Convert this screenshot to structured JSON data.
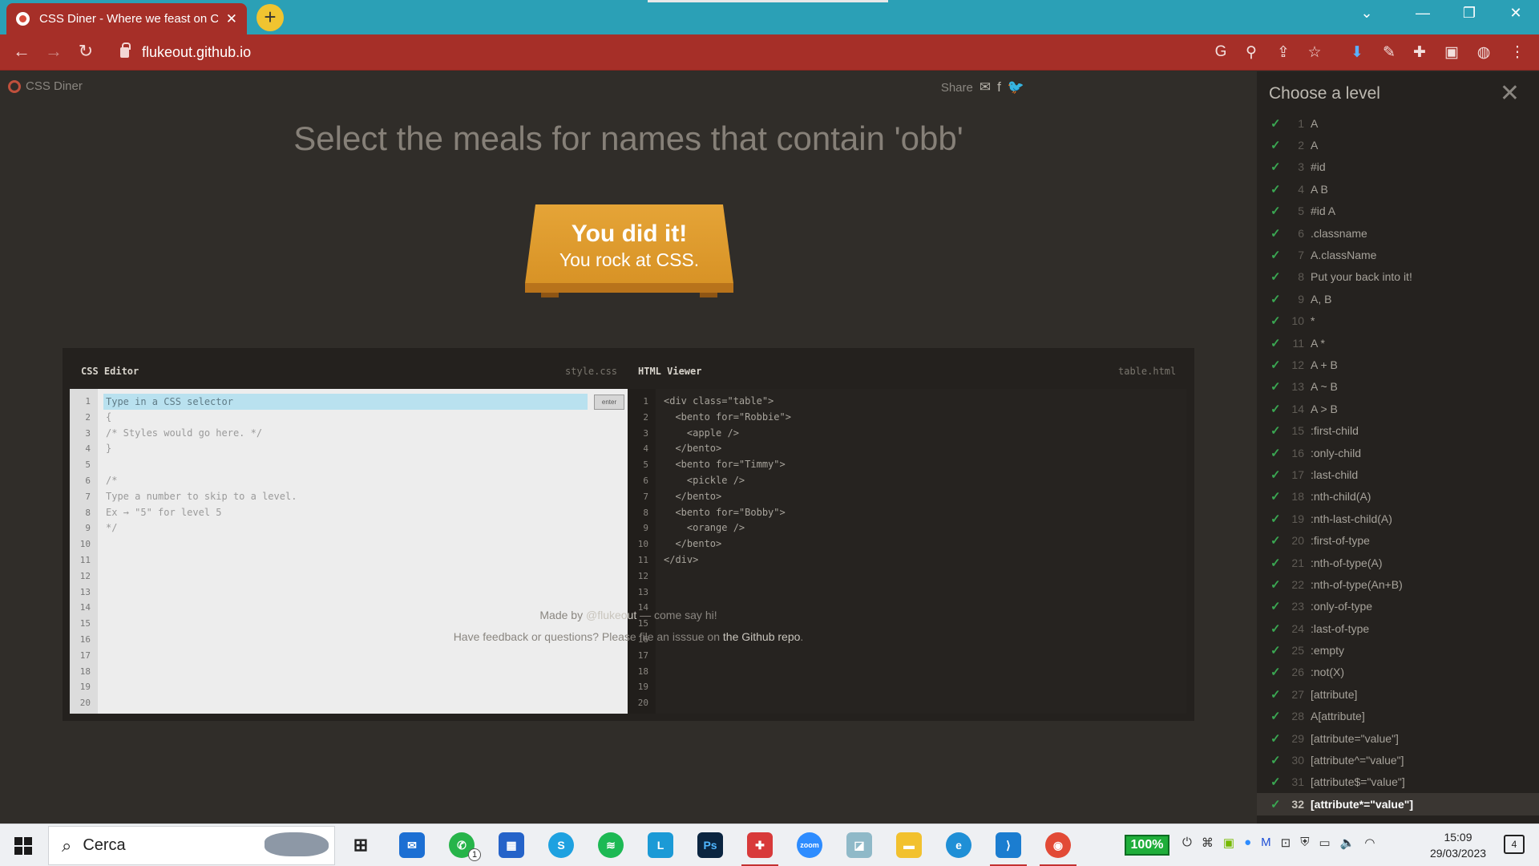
{
  "browser": {
    "tab_title": "CSS Diner - Where we feast on C",
    "url": "flukeout.github.io"
  },
  "page": {
    "logo": "CSS Diner",
    "share_label": "Share",
    "headline": "Select the meals for names that contain 'obb'",
    "plate_heading": "You did it!",
    "plate_subtext": "You rock at CSS.",
    "css_editor_title": "CSS Editor",
    "css_file": "style.css",
    "html_viewer_title": "HTML Viewer",
    "html_file": "table.html",
    "selector_placeholder": "Type in a CSS selector",
    "enter_label": "enter",
    "css_lines": [
      "",
      "{",
      "/* Styles would go here. */",
      "}",
      "",
      "/*",
      "Type a number to skip to a level.",
      "Ex → \"5\" for level 5",
      "*/"
    ],
    "html_lines": [
      "<div class=\"table\">",
      "  <bento for=\"Robbie\">",
      "    <apple />",
      "  </bento>",
      "  <bento for=\"Timmy\">",
      "    <pickle />",
      "  </bento>",
      "  <bento for=\"Bobby\">",
      "    <orange />",
      "  </bento>",
      "</div>"
    ],
    "line_numbers": [
      "1",
      "2",
      "3",
      "4",
      "5",
      "6",
      "7",
      "8",
      "9",
      "10",
      "11",
      "12",
      "13",
      "14",
      "15",
      "16",
      "17",
      "18",
      "19",
      "20"
    ],
    "footer_made_by_prefix": "Made by ",
    "footer_author": "@flukeout",
    "footer_made_by_suffix": " — come say hi!",
    "footer_feedback_prefix": "Have feedback or questions? Please file an isssue on ",
    "footer_repo": "the Github repo",
    "footer_feedback_suffix": "."
  },
  "sidebar": {
    "title": "Choose a level",
    "levels": [
      {
        "num": "1",
        "name": "A"
      },
      {
        "num": "2",
        "name": "A"
      },
      {
        "num": "3",
        "name": "#id"
      },
      {
        "num": "4",
        "name": "A B"
      },
      {
        "num": "5",
        "name": "#id A"
      },
      {
        "num": "6",
        "name": ".classname"
      },
      {
        "num": "7",
        "name": "A.className"
      },
      {
        "num": "8",
        "name": "Put your back into it!"
      },
      {
        "num": "9",
        "name": "A, B"
      },
      {
        "num": "10",
        "name": "*"
      },
      {
        "num": "11",
        "name": "A *"
      },
      {
        "num": "12",
        "name": "A + B"
      },
      {
        "num": "13",
        "name": "A ~ B"
      },
      {
        "num": "14",
        "name": "A > B"
      },
      {
        "num": "15",
        "name": ":first-child"
      },
      {
        "num": "16",
        "name": ":only-child"
      },
      {
        "num": "17",
        "name": ":last-child"
      },
      {
        "num": "18",
        "name": ":nth-child(A)"
      },
      {
        "num": "19",
        "name": ":nth-last-child(A)"
      },
      {
        "num": "20",
        "name": ":first-of-type"
      },
      {
        "num": "21",
        "name": ":nth-of-type(A)"
      },
      {
        "num": "22",
        "name": ":nth-of-type(An+B)"
      },
      {
        "num": "23",
        "name": ":only-of-type"
      },
      {
        "num": "24",
        "name": ":last-of-type"
      },
      {
        "num": "25",
        "name": ":empty"
      },
      {
        "num": "26",
        "name": ":not(X)"
      },
      {
        "num": "27",
        "name": "[attribute]"
      },
      {
        "num": "28",
        "name": "A[attribute]"
      },
      {
        "num": "29",
        "name": "[attribute=\"value\"]"
      },
      {
        "num": "30",
        "name": "[attribute^=\"value\"]"
      },
      {
        "num": "31",
        "name": "[attribute$=\"value\"]"
      },
      {
        "num": "32",
        "name": "[attribute*=\"value\"]"
      }
    ],
    "current_level": "32"
  },
  "taskbar": {
    "search_label": "Cerca",
    "battery": "100%",
    "time": "15:09",
    "date": "29/03/2023",
    "notification_count": "4",
    "whatsapp_badge": "1"
  },
  "colors": {
    "titlebar": "#2ba0b6",
    "browser_accent": "#a62f28",
    "page_bg": "#302d29",
    "plate": "#e5a437",
    "check": "#3aa752",
    "selector_highlight": "#b9e1ef"
  }
}
